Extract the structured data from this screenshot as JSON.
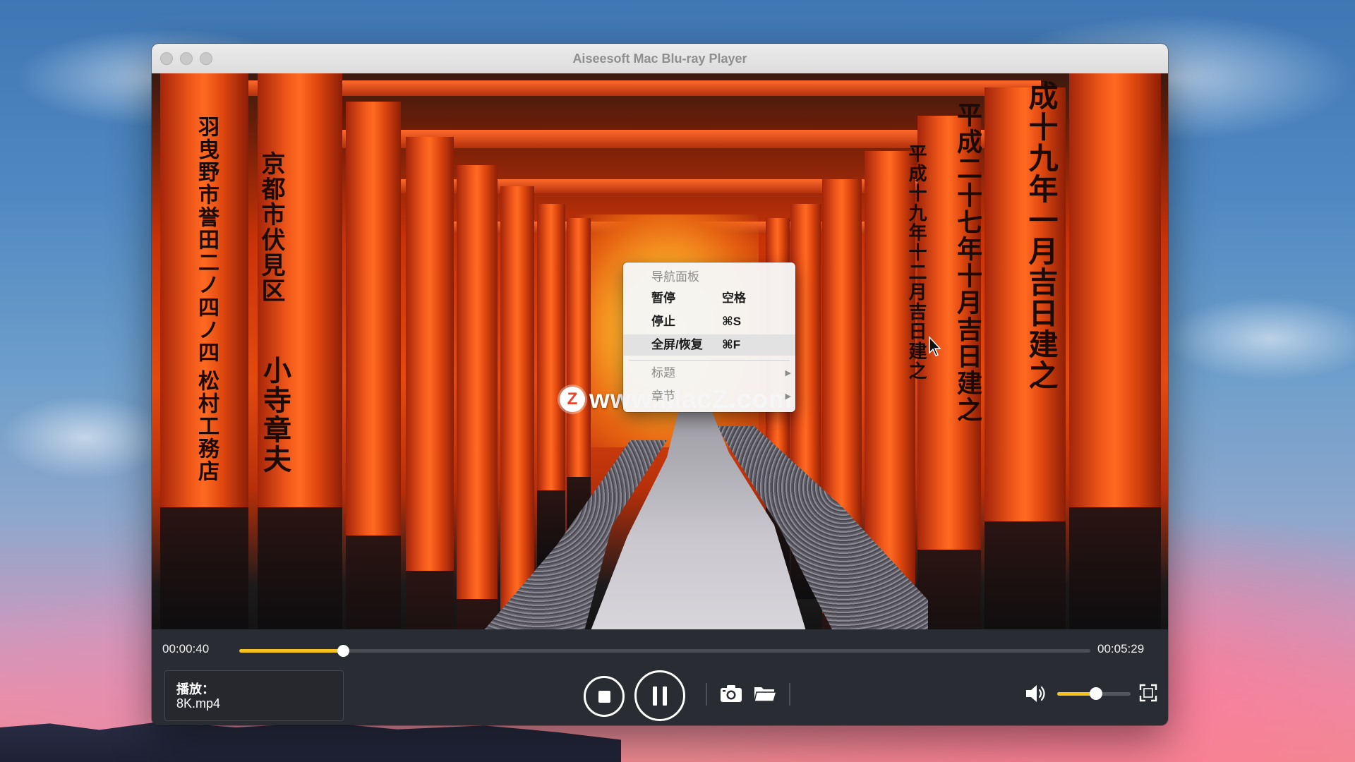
{
  "window": {
    "title": "Aiseesoft Mac Blu-ray Player"
  },
  "video": {
    "watermark_text": "www.MacZ.com",
    "watermark_logo": "Z"
  },
  "context_menu": {
    "items": [
      {
        "label": "导航面板",
        "shortcut": "",
        "enabled": false,
        "submenu": false
      },
      {
        "label": "暂停",
        "shortcut": "空格",
        "enabled": true,
        "submenu": false
      },
      {
        "label": "停止",
        "shortcut": "⌘S",
        "enabled": true,
        "submenu": false
      },
      {
        "label": "全屏/恢复",
        "shortcut": "⌘F",
        "enabled": true,
        "submenu": false,
        "selected": true
      },
      {
        "label": "标题",
        "shortcut": "",
        "enabled": false,
        "submenu": true
      },
      {
        "label": "章节",
        "shortcut": "",
        "enabled": false,
        "submenu": true
      }
    ]
  },
  "playback": {
    "current_time": "00:00:40",
    "total_time": "00:05:29",
    "progress_fraction": 0.1216,
    "status_label": "播放：",
    "file_name": "8K.mp4",
    "volume_fraction": 0.53
  },
  "icons": {
    "stop": "stop-icon",
    "pause": "pause-icon",
    "snapshot": "camera-icon",
    "open_folder": "folder-icon",
    "volume": "speaker-icon",
    "fullscreen": "fullscreen-icon"
  },
  "colors": {
    "accent": "#f6c21c",
    "control_bar": "#2a2c33"
  }
}
